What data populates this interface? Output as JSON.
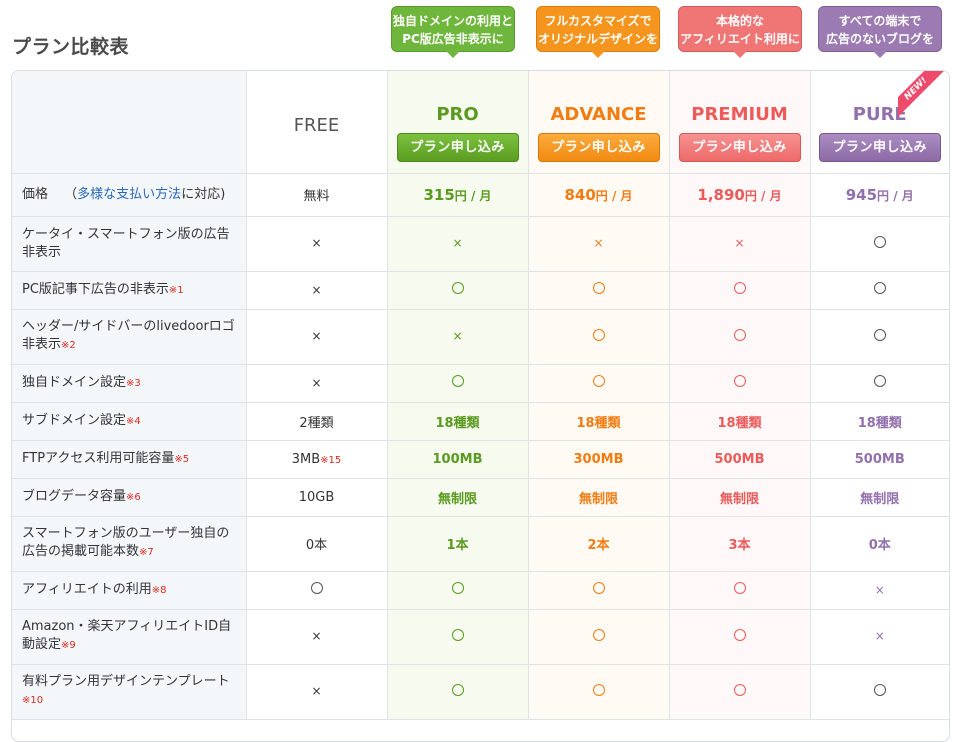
{
  "title": "プラン比較表",
  "callouts": {
    "pro": [
      "独自ドメインの利用と",
      "PC版広告非表示に"
    ],
    "adv": [
      "フルカスタマイズで",
      "オリジナルデザインを"
    ],
    "pre": [
      "本格的な",
      "アフィリエイト利用に"
    ],
    "pur": [
      "すべての端末で",
      "広告のないブログを"
    ]
  },
  "plans": {
    "free": "FREE",
    "pro": "PRO",
    "adv": "ADVANCE",
    "pre": "PREMIUM",
    "pur": "PURE"
  },
  "apply_label": "プラン申し込み",
  "new_badge": "NEW!",
  "price_row": {
    "label_pre": "価格",
    "label_link": "多様な支払い方法",
    "label_post": "に対応)",
    "label_open": "（",
    "free": "無料",
    "pro": "315",
    "adv": "840",
    "pre": "1,890",
    "pur": "945",
    "unit": "円 / 月"
  },
  "rows": [
    {
      "label": "ケータイ・スマートフォン版の広告非表示",
      "note": "",
      "cells": [
        "×",
        "×",
        "×",
        "×",
        "○"
      ]
    },
    {
      "label": "PC版記事下広告の非表示",
      "note": "※1",
      "cells": [
        "×",
        "○",
        "○",
        "○",
        "○"
      ]
    },
    {
      "label": "ヘッダー/サイドバーのlivedoorロゴ非表示",
      "note": "※2",
      "cells": [
        "×",
        "×",
        "○",
        "○",
        "○"
      ]
    },
    {
      "label": "独自ドメイン設定",
      "note": "※3",
      "cells": [
        "×",
        "○",
        "○",
        "○",
        "○"
      ]
    },
    {
      "label": "サブドメイン設定",
      "note": "※4",
      "cells": [
        "2種類",
        "18種類",
        "18種類",
        "18種類",
        "18種類"
      ]
    },
    {
      "label": "FTPアクセス利用可能容量",
      "note": "※5",
      "cells": [
        "3MB",
        "100MB",
        "300MB",
        "500MB",
        "500MB"
      ],
      "free_note": "※15"
    },
    {
      "label": "ブログデータ容量",
      "note": "※6",
      "cells": [
        "10GB",
        "無制限",
        "無制限",
        "無制限",
        "無制限"
      ]
    },
    {
      "label": "スマートフォン版のユーザー独自の広告の掲載可能本数",
      "note": "※7",
      "cells": [
        "0本",
        "1本",
        "2本",
        "3本",
        "0本"
      ]
    },
    {
      "label": "アフィリエイトの利用",
      "note": "※8",
      "cells": [
        "○",
        "○",
        "○",
        "○",
        "×"
      ]
    },
    {
      "label": "Amazon・楽天アフィリエイトID自動設定",
      "note": "※9",
      "cells": [
        "×",
        "○",
        "○",
        "○",
        "×"
      ]
    },
    {
      "label": "有料プラン用デザインテンプレート",
      "note": "※10",
      "cells": [
        "×",
        "○",
        "○",
        "○",
        "○"
      ]
    }
  ],
  "colors": {
    "pro": "#5a9a1f",
    "adv": "#f37c12",
    "pre": "#ec5a5a",
    "pur": "#9270ad"
  }
}
